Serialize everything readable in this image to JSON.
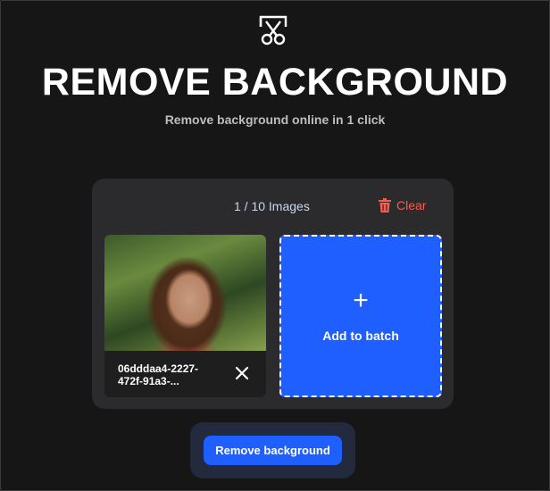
{
  "header": {
    "logo_icon": "scissors-frame-icon",
    "title": "REMOVE BACKGROUND",
    "subtitle": "Remove background online in 1 click"
  },
  "batch": {
    "count_label": "1 / 10 Images",
    "clear_label": "Clear",
    "clear_icon": "trash-icon",
    "items": [
      {
        "filename": "06dddaa4-2227-472f-91a3-...",
        "remove_icon": "close-icon"
      }
    ],
    "add_icon": "plus-icon",
    "add_label": "Add to batch"
  },
  "action": {
    "button_label": "Remove background"
  },
  "colors": {
    "background": "#161616",
    "panel": "#2b2b2d",
    "accent": "#1f5fff",
    "danger": "#ff5a4a"
  }
}
